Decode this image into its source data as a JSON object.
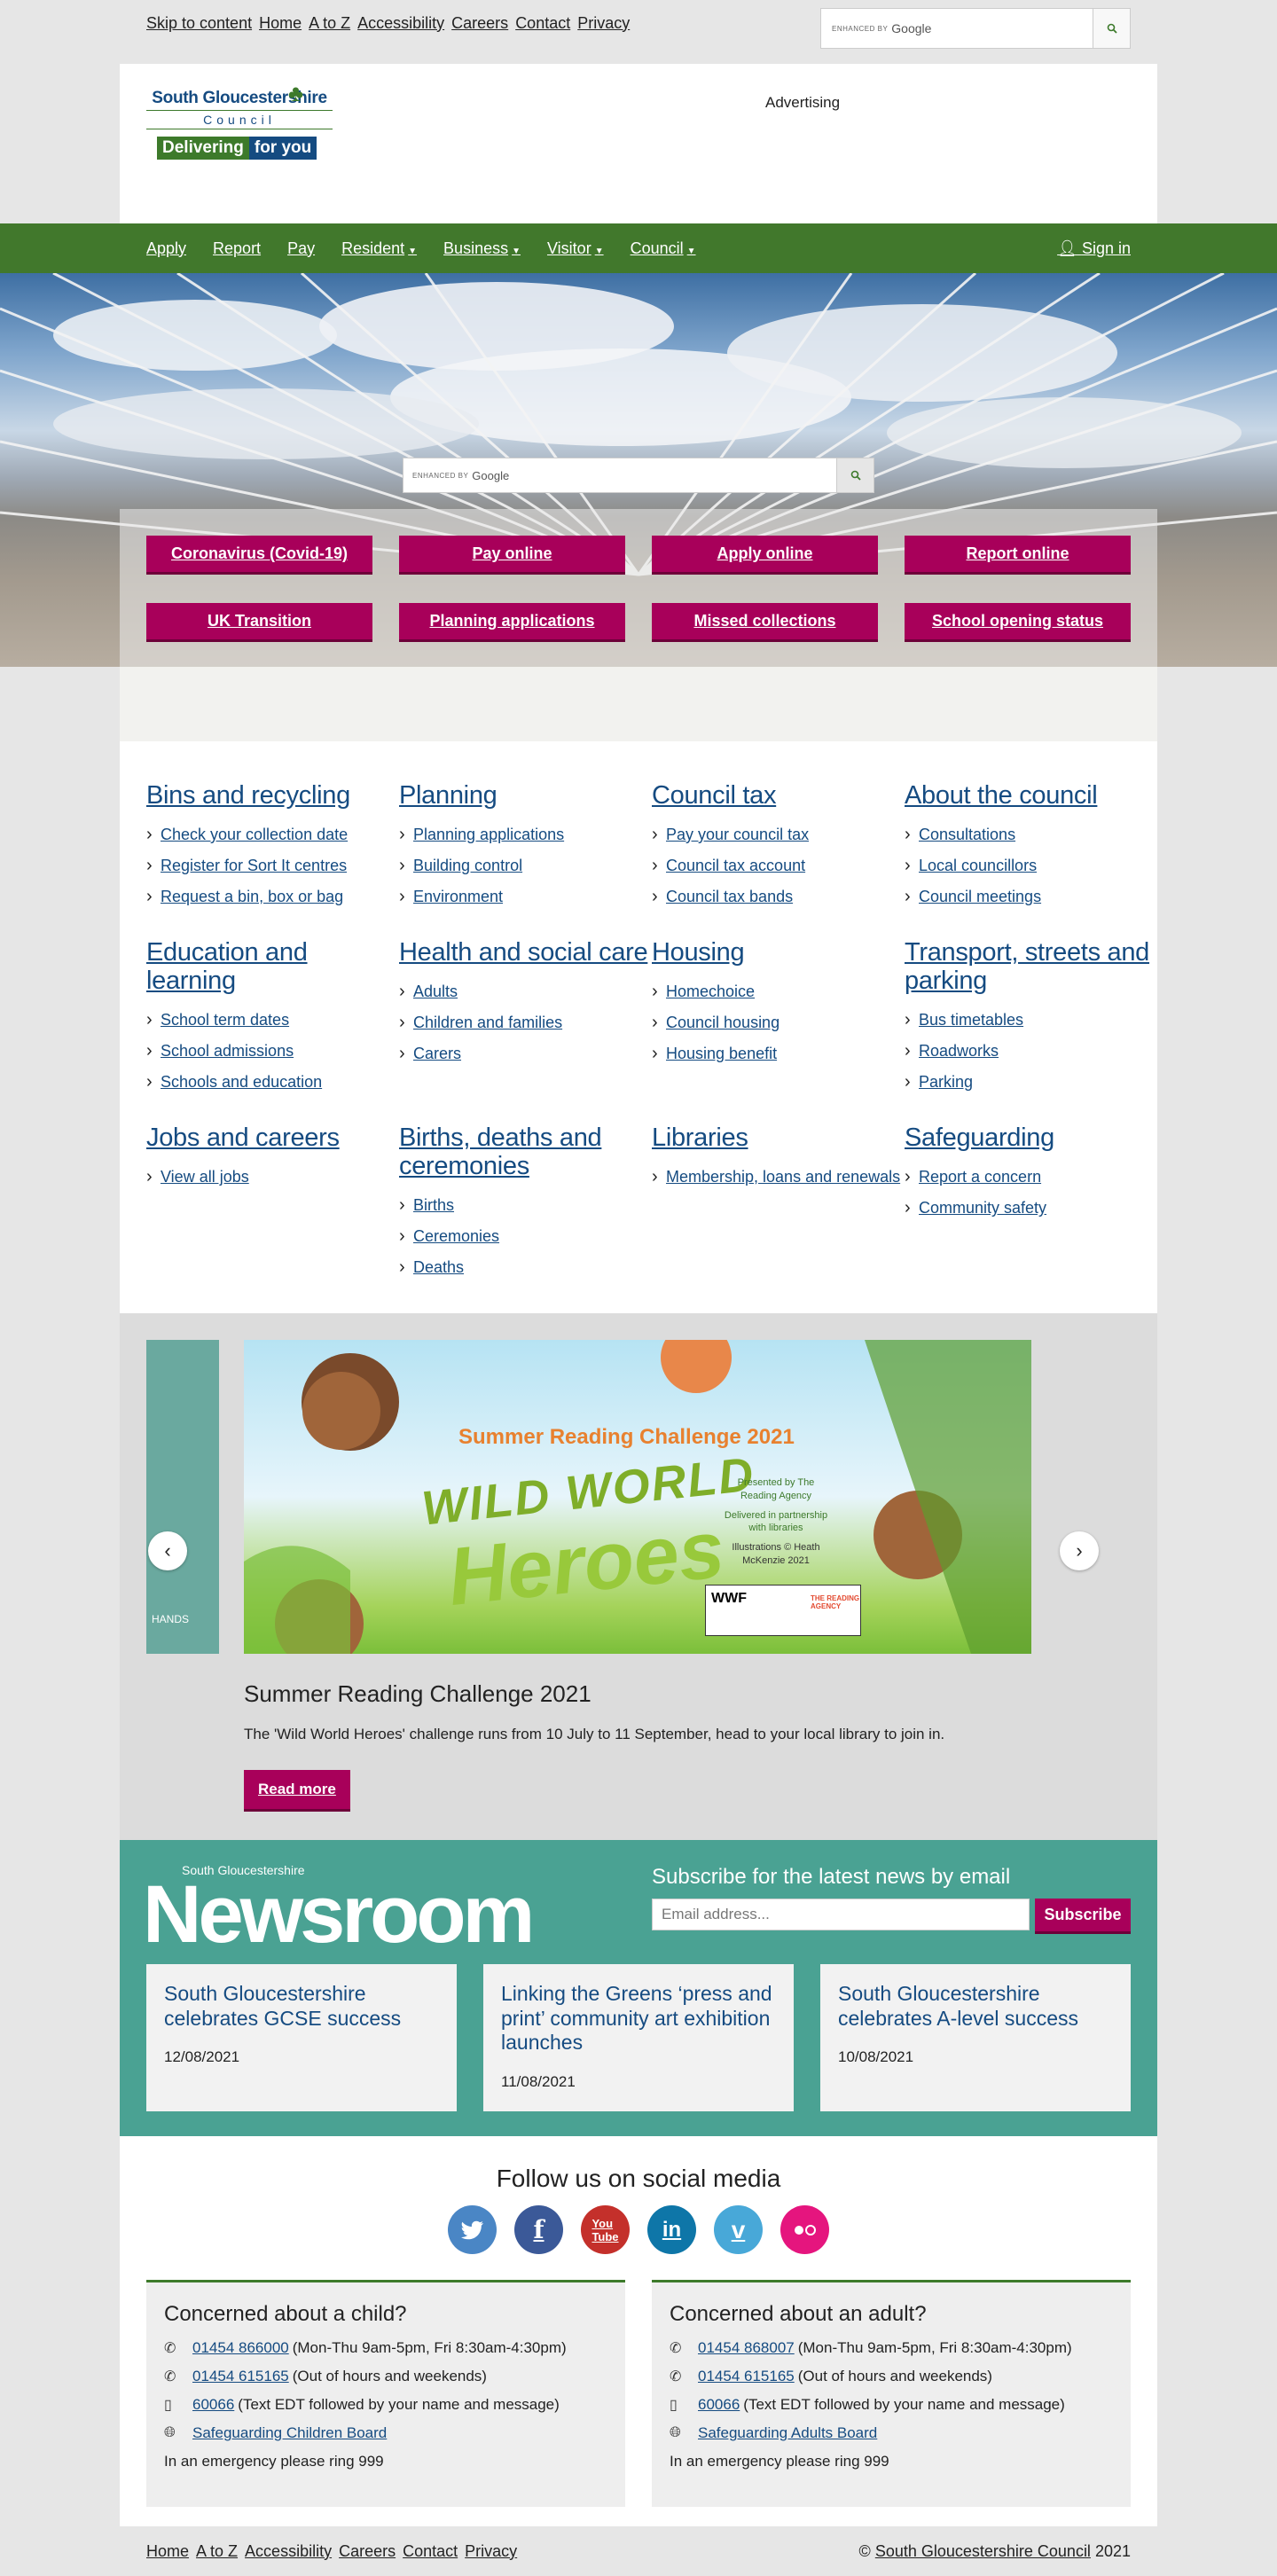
{
  "topbar": {
    "links": [
      "Skip to content",
      "Home",
      "A to Z",
      "Accessibility",
      "Careers",
      "Contact",
      "Privacy"
    ],
    "search_label": "ENHANCED BY",
    "search_brand": "Google"
  },
  "header": {
    "logo_name": "South Gloucestershire",
    "logo_council": "Council",
    "logo_tag_1": "Delivering",
    "logo_tag_2": "for you",
    "advertising": "Advertising"
  },
  "nav": {
    "items": [
      "Apply",
      "Report",
      "Pay",
      "Resident",
      "Business",
      "Visitor",
      "Council"
    ],
    "sign_in": "Sign in"
  },
  "hero": {
    "search_label": "ENHANCED BY",
    "search_brand": "Google"
  },
  "quick_links": [
    "Coronavirus (Covid-19)",
    "Pay online",
    "Apply online",
    "Report online",
    "UK Transition",
    "Planning applications",
    "Missed collections",
    "School opening status"
  ],
  "services": [
    {
      "title": "Bins and recycling",
      "links": [
        "Check your collection date",
        "Register for Sort It centres",
        "Request a bin, box or bag"
      ]
    },
    {
      "title": "Planning",
      "links": [
        "Planning applications",
        "Building control",
        "Environment"
      ]
    },
    {
      "title": "Council tax",
      "links": [
        "Pay your council tax",
        "Council tax account",
        "Council tax bands"
      ]
    },
    {
      "title": "About the council",
      "links": [
        "Consultations",
        "Local councillors",
        "Council meetings"
      ]
    },
    {
      "title": "Education and learning",
      "links": [
        "School term dates",
        "School admissions",
        "Schools and education"
      ]
    },
    {
      "title": "Health and social care",
      "links": [
        "Adults",
        "Children and families",
        "Carers"
      ]
    },
    {
      "title": "Housing",
      "links": [
        "Homechoice",
        "Council housing",
        "Housing benefit"
      ]
    },
    {
      "title": "Transport, streets and parking",
      "links": [
        "Bus timetables",
        "Roadworks",
        "Parking"
      ]
    },
    {
      "title": "Jobs and careers",
      "links": [
        "View all jobs"
      ]
    },
    {
      "title": "Births, deaths and ceremonies",
      "links": [
        "Births",
        "Ceremonies",
        "Deaths"
      ]
    },
    {
      "title": "Libraries",
      "links": [
        "Membership, loans and renewals"
      ]
    },
    {
      "title": "Safeguarding",
      "links": [
        "Report a concern",
        "Community safety"
      ]
    }
  ],
  "carousel": {
    "prev_label": "HANDS",
    "image_title": "Summer Reading Challenge 2021",
    "image_wild": "WILD WORLD",
    "image_heroes": "Heroes",
    "image_presented": "Presented by The Reading Agency",
    "image_delivered": "Delivered in partnership with libraries",
    "image_illustrations": "Illustrations © Heath McKenzie 2021",
    "image_wwf": "WWF",
    "image_ra": "THE READING AGENCY",
    "title": "Summer Reading Challenge 2021",
    "text": "The 'Wild World Heroes' challenge runs from 10 July to 11 September, head to your local library to join in.",
    "read_more": "Read more"
  },
  "newsroom": {
    "small": "South Gloucestershire",
    "big": "Newsroom",
    "subscribe_title": "Subscribe for the latest news by email",
    "email_placeholder": "Email address...",
    "subscribe_button": "Subscribe",
    "articles": [
      {
        "title": "South Gloucestershire celebrates GCSE success",
        "date": "12/08/2021"
      },
      {
        "title": "Linking the Greens ‘press and print’ community art exhibition launches",
        "date": "11/08/2021"
      },
      {
        "title": "South Gloucestershire celebrates A-level success",
        "date": "10/08/2021"
      }
    ]
  },
  "social": {
    "title": "Follow us on social media",
    "icons": [
      "twitter-icon",
      "facebook-icon",
      "youtube-icon",
      "linkedin-icon",
      "vimeo-icon",
      "flickr-icon"
    ],
    "colors": [
      "#4a86c5",
      "#3b5998",
      "#c4302b",
      "#0e76a8",
      "#48a8d8",
      "#e5157e"
    ]
  },
  "concern": [
    {
      "title": "Concerned about a child?",
      "phone1": "01454 866000",
      "phone1_note": "(Mon-Thu 9am-5pm, Fri 8:30am-4:30pm)",
      "phone2": "01454 615165",
      "phone2_note": "(Out of hours and weekends)",
      "text": "60066",
      "text_note": "(Text EDT followed by your name and message)",
      "board": "Safeguarding Children Board",
      "emergency": "In an emergency please ring 999"
    },
    {
      "title": "Concerned about an adult?",
      "phone1": "01454 868007",
      "phone1_note": "(Mon-Thu 9am-5pm, Fri 8:30am-4:30pm)",
      "phone2": "01454 615165",
      "phone2_note": "(Out of hours and weekends)",
      "text": "60066",
      "text_note": "(Text EDT followed by your name and message)",
      "board": "Safeguarding Adults Board",
      "emergency": "In an emergency please ring 999"
    }
  ],
  "footer": {
    "links": [
      "Home",
      "A to Z",
      "Accessibility",
      "Careers",
      "Contact",
      "Privacy"
    ],
    "copyright_prefix": "©",
    "copyright_org": "South Gloucestershire Council",
    "copyright_year": "2021"
  }
}
